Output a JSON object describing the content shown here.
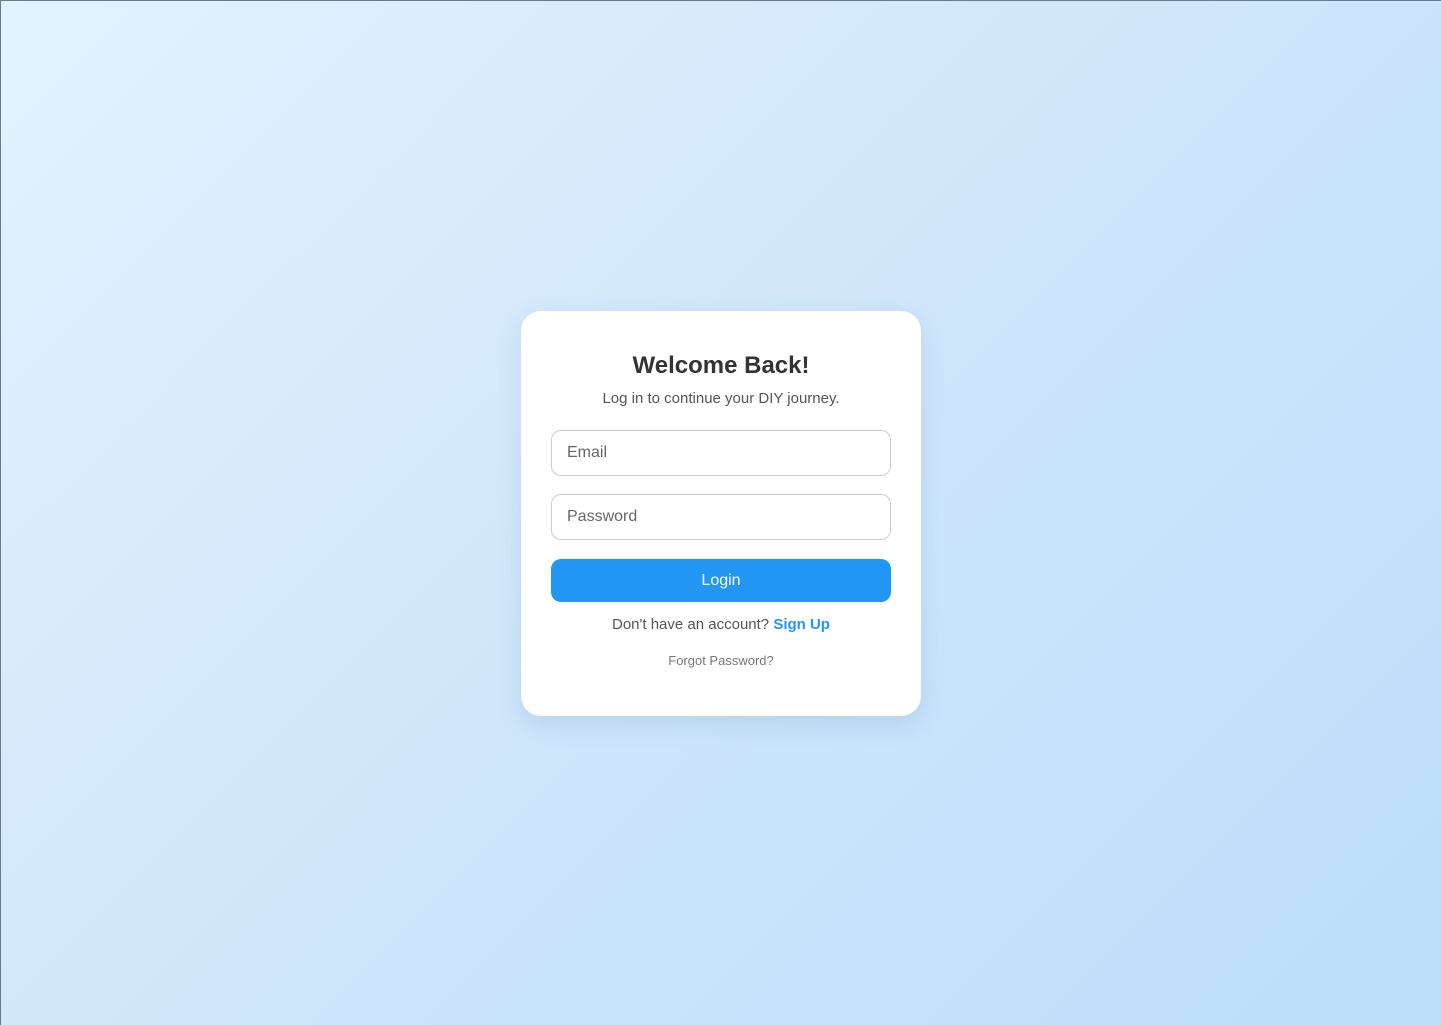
{
  "login_card": {
    "title": "Welcome Back!",
    "subtitle": "Log in to continue your DIY journey.",
    "email": {
      "value": "",
      "placeholder": "Email"
    },
    "password": {
      "value": "",
      "placeholder": "Password"
    },
    "login_label": "Login",
    "signup_prompt": "Don't have an account?",
    "signup_label": "Sign Up",
    "forgot_label": "Forgot Password?"
  },
  "colors": {
    "accent": "#2196f3",
    "background_start": "#e3f2fd",
    "background_end": "#bbdefb",
    "title_text": "#333333",
    "body_text": "#555555"
  }
}
